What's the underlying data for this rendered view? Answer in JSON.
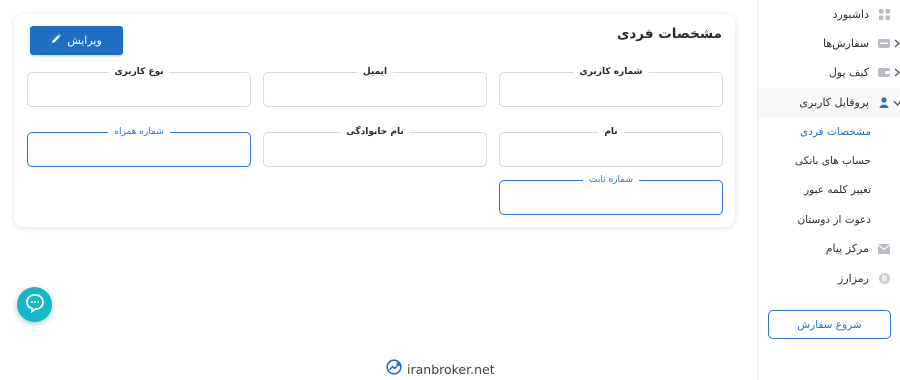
{
  "sidebar": {
    "items": [
      {
        "label": "داشبورد",
        "icon": "grid-icon",
        "expandable": false
      },
      {
        "label": "سفارش‌ها",
        "icon": "orders-icon",
        "expandable": true
      },
      {
        "label": "کیف پول",
        "icon": "wallet-icon",
        "expandable": true
      },
      {
        "label": "پروفایل کاربری",
        "icon": "user-icon",
        "expandable": true,
        "expanded": true
      },
      {
        "label": "مرکز پیام",
        "icon": "mail-icon",
        "expandable": false
      },
      {
        "label": "رمزارز",
        "icon": "bitcoin-icon",
        "expandable": false
      }
    ],
    "profile_sub": [
      {
        "label": "مشخصات فردی",
        "active": true
      },
      {
        "label": "حساب های بانکی",
        "active": false
      },
      {
        "label": "تغییر کلمه عبور",
        "active": false
      },
      {
        "label": "دعوت از دوستان",
        "active": false
      }
    ],
    "start_order_label": "شروع سفارش"
  },
  "card": {
    "title": "مشخصات فردی",
    "edit_label": "ویرایش",
    "fields": {
      "user_id": {
        "label": "شماره کاربری",
        "value": ""
      },
      "email": {
        "label": "ایمیل",
        "value": ""
      },
      "user_type": {
        "label": "نوع کاربری",
        "value": ""
      },
      "first_name": {
        "label": "نام",
        "value": ""
      },
      "last_name": {
        "label": "نام خانوادگی",
        "value": ""
      },
      "mobile": {
        "label": "شماره همراه",
        "value": ""
      },
      "landline": {
        "label": "شماره ثابت",
        "value": ""
      }
    }
  },
  "brand": {
    "text": "iranbroker.net"
  },
  "colors": {
    "accent": "#1f6fc4",
    "chat": "#14b8c6",
    "focus_border": "#2a73c8"
  }
}
